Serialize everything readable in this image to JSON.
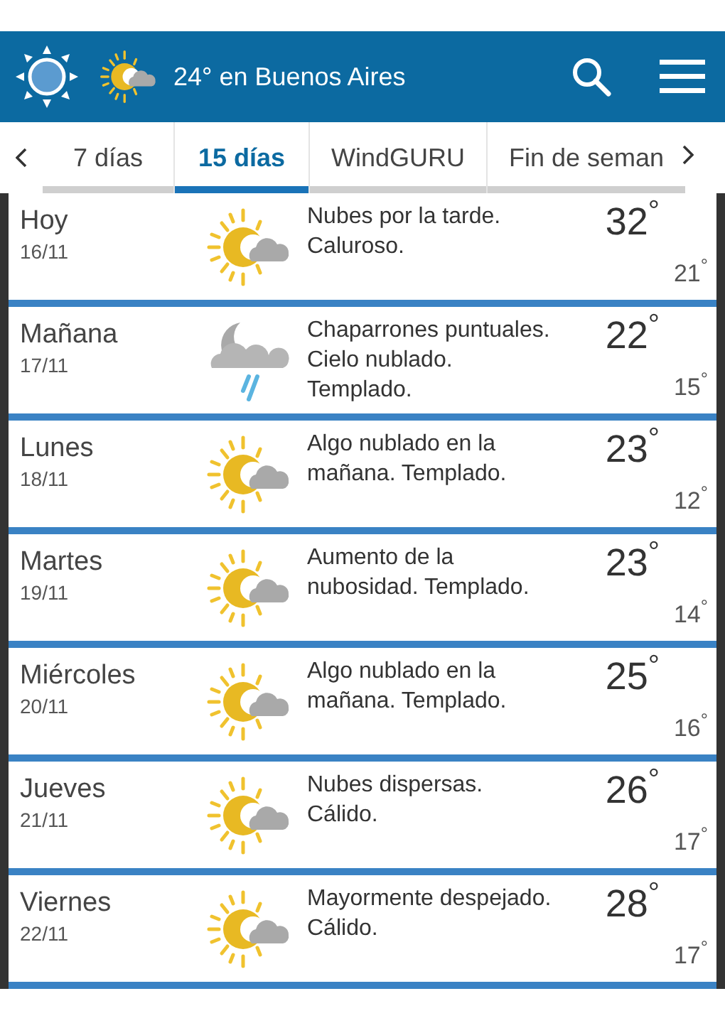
{
  "header": {
    "title": "24° en Buenos Aires"
  },
  "tabs": [
    {
      "label": "7 días",
      "selected": false
    },
    {
      "label": "15 días",
      "selected": true
    },
    {
      "label": "WindGURU",
      "selected": false
    },
    {
      "label": "Fin de seman",
      "selected": false
    }
  ],
  "days": [
    {
      "day": "Hoy",
      "date": "16/11",
      "kind": "sun_cloud",
      "description": "Nubes por la tarde. Caluroso.",
      "max": "32$^{°}$",
      "min": "21$^{°}$"
    },
    {
      "day": "Mañana",
      "date": "17/11",
      "kind": "moon_cloud_rain",
      "description": "Chaparrones puntuales. Cielo nublado. Templado.",
      "max": "22$^{°}$",
      "min": "15$^{°}$"
    },
    {
      "day": "Lunes",
      "date": "18/11",
      "kind": "sun_cloud",
      "description": "Algo nublado en la mañana. Templado.",
      "max": "23$^{°}$",
      "min": "12$^{°}$"
    },
    {
      "day": "Martes",
      "date": "19/11",
      "kind": "sun_cloud",
      "description": "Aumento de la nubosidad. Templado.",
      "max": "23$^{°}$",
      "min": "14$^{°}$"
    },
    {
      "day": "Miércoles",
      "date": "20/11",
      "kind": "sun_cloud",
      "description": "Algo nublado en la mañana. Templado.",
      "max": "25$^{°}$",
      "min": "16$^{°}$"
    },
    {
      "day": "Jueves",
      "date": "21/11",
      "kind": "sun_cloud",
      "description": "Nubes dispersas. Cálido.",
      "max": "26$^{°}$",
      "min": "17$^{°}$"
    },
    {
      "day": "Viernes",
      "date": "22/11",
      "kind": "sun_cloud",
      "description": "Mayormente despejado. Cálido.",
      "max": "28$^{°}$",
      "min": "17$^{°}$"
    }
  ]
}
